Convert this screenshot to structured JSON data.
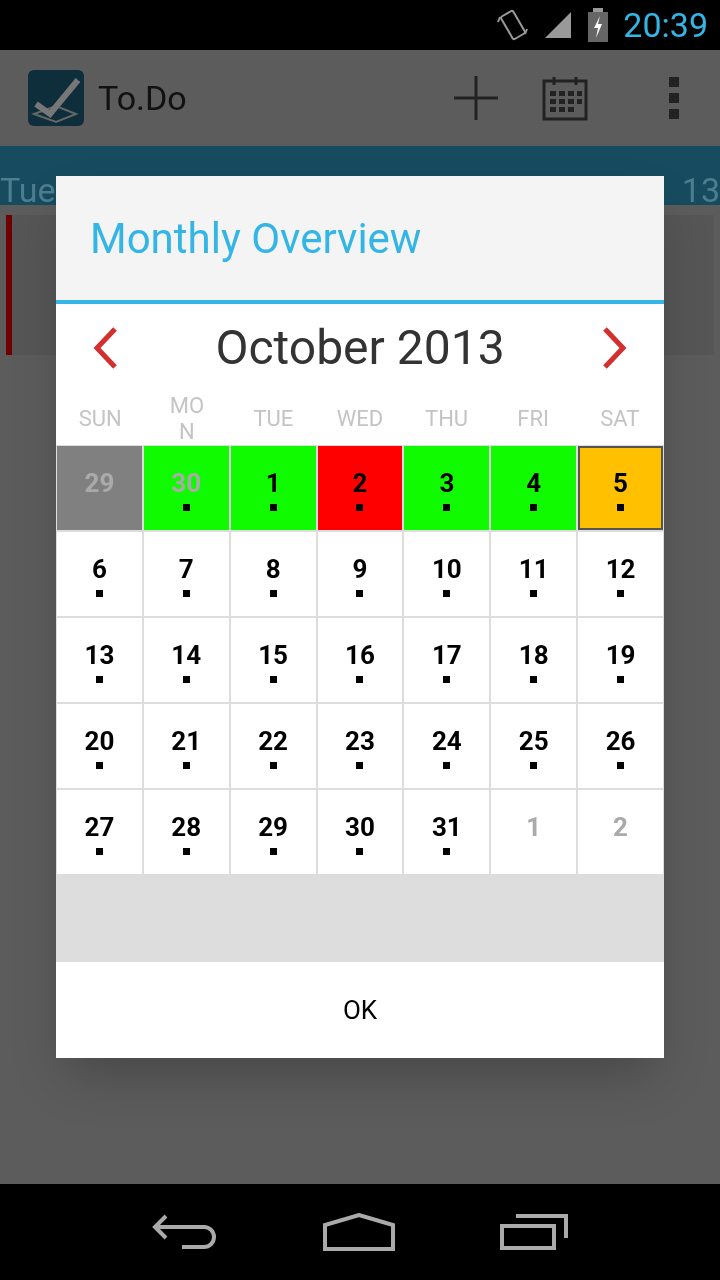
{
  "status_bar": {
    "time": "20:39"
  },
  "app_bar": {
    "title": "To.Do"
  },
  "date_strip": [
    "Tue",
    "13"
  ],
  "dialog": {
    "title": "Monthly Overview",
    "month": "October 2013",
    "weekdays": [
      "SUN",
      "MO\nN",
      "TUE",
      "WED",
      "THU",
      "FRI",
      "SAT"
    ],
    "days": [
      {
        "label": "29",
        "in_month": false,
        "color": "#808080",
        "dot": false,
        "selected": false
      },
      {
        "label": "30",
        "in_month": false,
        "color": "#11fb00",
        "dot": true,
        "selected": false
      },
      {
        "label": "1",
        "in_month": true,
        "color": "#11fb00",
        "dot": true,
        "selected": false
      },
      {
        "label": "2",
        "in_month": true,
        "color": "#ff0000",
        "dot": true,
        "selected": false
      },
      {
        "label": "3",
        "in_month": true,
        "color": "#11fb00",
        "dot": true,
        "selected": false
      },
      {
        "label": "4",
        "in_month": true,
        "color": "#11fb00",
        "dot": true,
        "selected": false
      },
      {
        "label": "5",
        "in_month": true,
        "color": "#ffc000",
        "dot": true,
        "selected": true
      },
      {
        "label": "6",
        "in_month": true,
        "dot": true,
        "selected": false
      },
      {
        "label": "7",
        "in_month": true,
        "dot": true,
        "selected": false
      },
      {
        "label": "8",
        "in_month": true,
        "dot": true,
        "selected": false
      },
      {
        "label": "9",
        "in_month": true,
        "dot": true,
        "selected": false
      },
      {
        "label": "10",
        "in_month": true,
        "dot": true,
        "selected": false
      },
      {
        "label": "11",
        "in_month": true,
        "dot": true,
        "selected": false
      },
      {
        "label": "12",
        "in_month": true,
        "dot": true,
        "selected": false
      },
      {
        "label": "13",
        "in_month": true,
        "dot": true,
        "selected": false
      },
      {
        "label": "14",
        "in_month": true,
        "dot": true,
        "selected": false
      },
      {
        "label": "15",
        "in_month": true,
        "dot": true,
        "selected": false
      },
      {
        "label": "16",
        "in_month": true,
        "dot": true,
        "selected": false
      },
      {
        "label": "17",
        "in_month": true,
        "dot": true,
        "selected": false
      },
      {
        "label": "18",
        "in_month": true,
        "dot": true,
        "selected": false
      },
      {
        "label": "19",
        "in_month": true,
        "dot": true,
        "selected": false
      },
      {
        "label": "20",
        "in_month": true,
        "dot": true,
        "selected": false
      },
      {
        "label": "21",
        "in_month": true,
        "dot": true,
        "selected": false
      },
      {
        "label": "22",
        "in_month": true,
        "dot": true,
        "selected": false
      },
      {
        "label": "23",
        "in_month": true,
        "dot": true,
        "selected": false
      },
      {
        "label": "24",
        "in_month": true,
        "dot": true,
        "selected": false
      },
      {
        "label": "25",
        "in_month": true,
        "dot": true,
        "selected": false
      },
      {
        "label": "26",
        "in_month": true,
        "dot": true,
        "selected": false
      },
      {
        "label": "27",
        "in_month": true,
        "dot": true,
        "selected": false
      },
      {
        "label": "28",
        "in_month": true,
        "dot": true,
        "selected": false
      },
      {
        "label": "29",
        "in_month": true,
        "dot": true,
        "selected": false
      },
      {
        "label": "30",
        "in_month": true,
        "dot": true,
        "selected": false
      },
      {
        "label": "31",
        "in_month": true,
        "dot": true,
        "selected": false
      },
      {
        "label": "1",
        "in_month": false,
        "dot": false,
        "selected": false
      },
      {
        "label": "2",
        "in_month": false,
        "dot": false,
        "selected": false
      }
    ],
    "button": "OK"
  }
}
